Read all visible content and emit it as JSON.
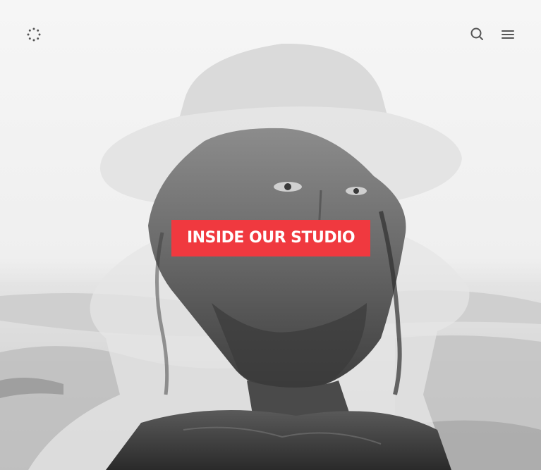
{
  "header": {
    "logo_icon": "dotted-circle-logo-icon",
    "search_icon": "search-icon",
    "menu_icon": "hamburger-menu-icon"
  },
  "hero": {
    "cta_label": "INSIDE OUR STUDIO",
    "accent_color": "#f0393f"
  }
}
